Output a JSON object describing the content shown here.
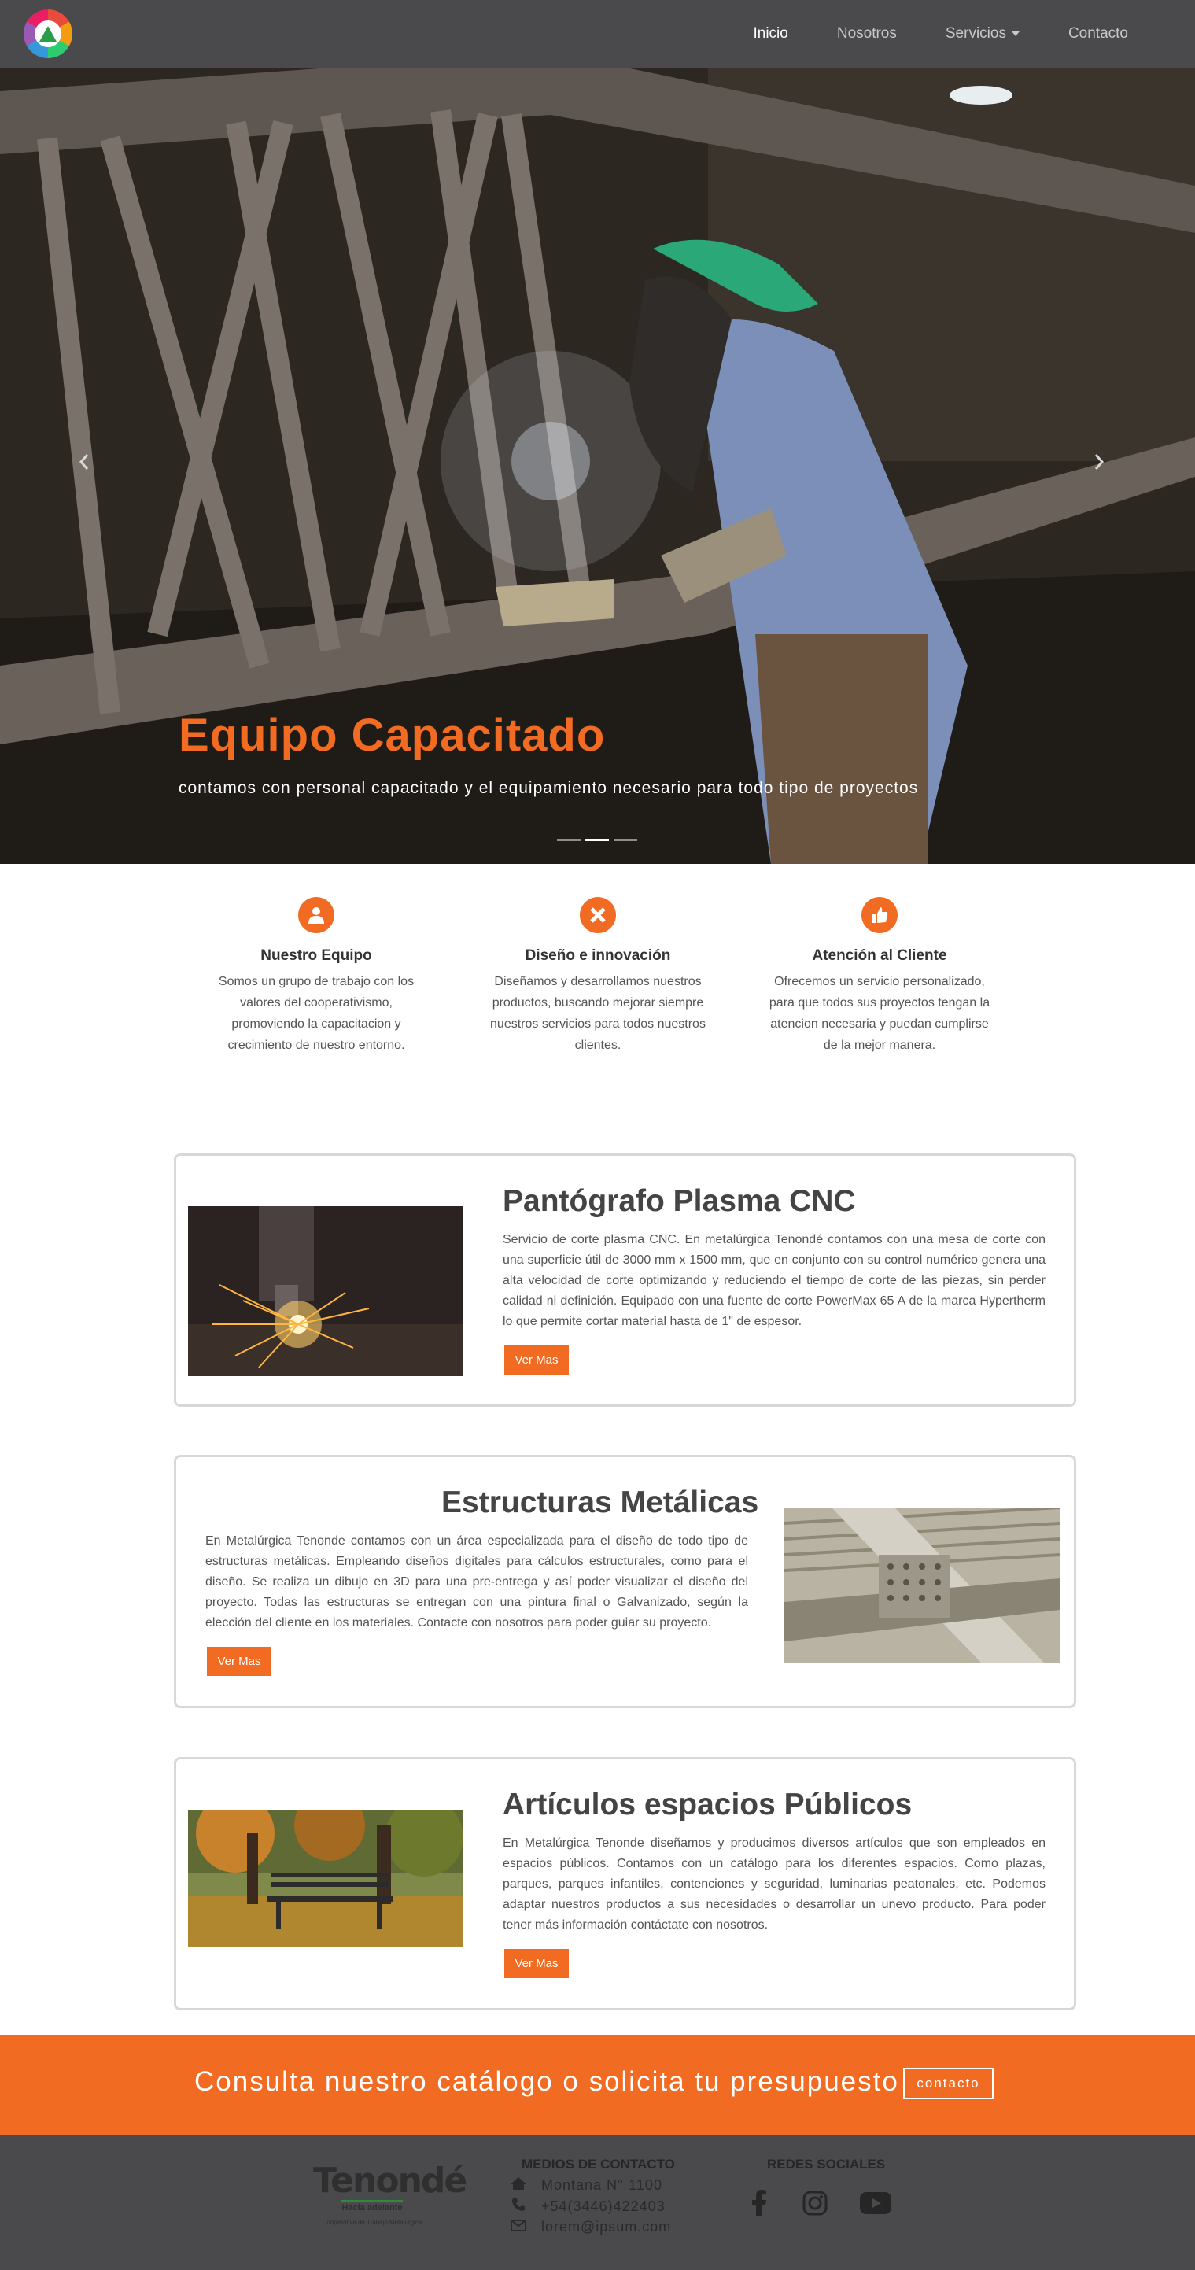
{
  "nav": {
    "logo": "logo-icon",
    "items": [
      {
        "label": "Inicio",
        "active": true
      },
      {
        "label": "Nosotros",
        "active": false
      },
      {
        "label": "Servicios",
        "active": false
      },
      {
        "label": "Contacto",
        "active": false
      }
    ]
  },
  "hero": {
    "title": "Equipo Capacitado",
    "subtitle": "contamos con personal capacitado y el equipamiento necesario para todo tipo de proyectos",
    "prev_icon": "chevron-left-icon",
    "next_icon": "chevron-right-icon",
    "slides": 3,
    "active_slide": 2
  },
  "features": [
    {
      "icon": "team-icon",
      "title": "Nuestro Equipo",
      "lines": [
        "Somos un grupo de trabajo con los",
        "valores del cooperativismo,",
        "promoviendo la capacitacion y",
        "crecimiento de nuestro entorno."
      ]
    },
    {
      "icon": "design-icon",
      "title": "Diseño e innovación",
      "lines": [
        "Diseñamos y desarrollamos nuestros",
        "productos, buscando mejorar siempre",
        "nuestros servicios para todos nuestros",
        "clientes."
      ]
    },
    {
      "icon": "thumbs-up-icon",
      "title": "Atención al Cliente",
      "lines": [
        "Ofrecemos un servicio personalizado,",
        "para que todos sus proyectos tengan la",
        "atencion necesaria y puedan cumplirse",
        "de la mejor manera."
      ]
    }
  ],
  "cards": [
    {
      "title": "Pantógrafo Plasma CNC",
      "text": "Servicio de corte plasma CNC. En metalúrgica Tenondé contamos con una mesa de corte con una superficie útil de 3000 mm x 1500 mm, que en conjunto con su control numérico genera una alta velocidad de corte optimizando y reduciendo el tiempo de corte de las piezas, sin perder calidad ni definición. Equipado con una fuente de corte PowerMax 65 A de la marca Hypertherm lo que permite cortar material hasta de 1\" de espesor.",
      "button": "Ver Mas"
    },
    {
      "title": "Estructuras Metálicas",
      "text": "En Metalúrgica Tenonde contamos con un área especializada para el diseño de todo tipo de estructuras metálicas. Empleando diseños digitales para cálculos estructurales, como para el diseño. Se realiza un dibujo en 3D para una pre-entrega y así poder visualizar el diseño del proyecto. Todas las estructuras se entregan con una pintura final o Galvanizado, según la elección del cliente en los materiales. Contacte con nosotros para poder guiar su proyecto.",
      "button": "Ver Mas"
    },
    {
      "title": "Artículos espacios Públicos",
      "text": "En Metalúrgica Tenonde diseñamos y producimos diversos artículos que son empleados en espacios públicos. Contamos con un catálogo para los diferentes espacios. Como plazas, parques, parques infantiles, contenciones y seguridad, luminarias peatonales, etc. Podemos adaptar nuestros productos a sus necesidades o desarrollar un unevo producto. Para poder tener más información contáctate con nosotros.",
      "button": "Ver Mas"
    }
  ],
  "cta": {
    "text": "Consulta nuestro catálogo o solicita tu presupuesto",
    "button": "contacto"
  },
  "footer": {
    "brand": "Tenondé",
    "tagline": "Hacia adelante",
    "tagline2": "Cooperativa de Trabajo Metalúrgica",
    "contact_title": "MEDIOS DE CONTACTO",
    "contacts": [
      {
        "icon": "home-icon",
        "text": "Montana N° 1100"
      },
      {
        "icon": "phone-icon",
        "text": "+54(3446)422403"
      },
      {
        "icon": "envelope-icon",
        "text": "lorem@ipsum.com"
      }
    ],
    "social_title": "REDES SOCIALES",
    "social": [
      "facebook-icon",
      "instagram-icon",
      "youtube-icon"
    ]
  }
}
